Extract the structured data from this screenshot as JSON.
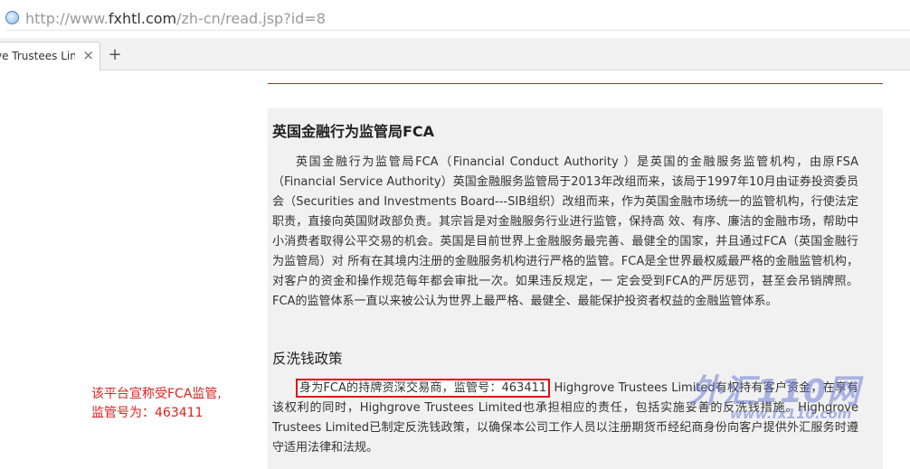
{
  "browser": {
    "url_prefix": "http://www.",
    "url_host": "fxhtl.com",
    "url_path": "/zh-cn/read.jsp?id=8",
    "tab_title": "ve Trustees Lin",
    "tab_close": "×",
    "new_tab": "+"
  },
  "article": {
    "title": "英国金融行为监管局FCA",
    "paragraph1": "英国金融行为监管局FCA（Financial Conduct Authority ）是英国的金融服务监管机构，由原FSA（Financial Service Authority）英国金融服务监管局于2013年改组而来，该局于1997年10月由证券投资委员会（Securities and Investments Board---SIB组织）改组而来，作为英国金融市场统一的监管机构，行使法定职责，直接向英国财政部负责。其宗旨是对金融服务行业进行监管，保持高 效、有序、廉洁的金融市场，帮助中小消费者取得公平交易的机会。英国是目前世界上金融服务最完善、最健全的国家，并且通过FCA（英国金融行为监管局）对 所有在其境内注册的金融服务机构进行严格的监管。FCA是全世界最权威最严格的金融监管机构，对客户的资金和操作规范每年都会审批一次。如果违反规定，一 定会受到FCA的严厉惩罚，甚至会吊销牌照。FCA的监管体系一直以来被公认为世界上最严格、最健全、最能保护投资者权益的金融监管体系。",
    "section2_title": "反洗钱政策",
    "highlight": "身为FCA的持牌资深交易商，监管号：463411",
    "paragraph2_rest": "Highgrove Trustees Limited有权持有客户资金，在享有该权利的同时，Highgrove Trustees Limited也承担相应的责任，包括实施妥善的反洗钱措施。Highgrove Trustees Limited已制定反洗钱政策，以确保本公司工作人员以注册期货币经纪商身份向客户提供外汇服务时遵守适用法律和法规。"
  },
  "annotation": {
    "line1": "该平台宣称受FCA监管,",
    "line2": "监管号为：463411"
  },
  "watermark": {
    "main": "外汇110网",
    "url": "www.fx110.com"
  }
}
